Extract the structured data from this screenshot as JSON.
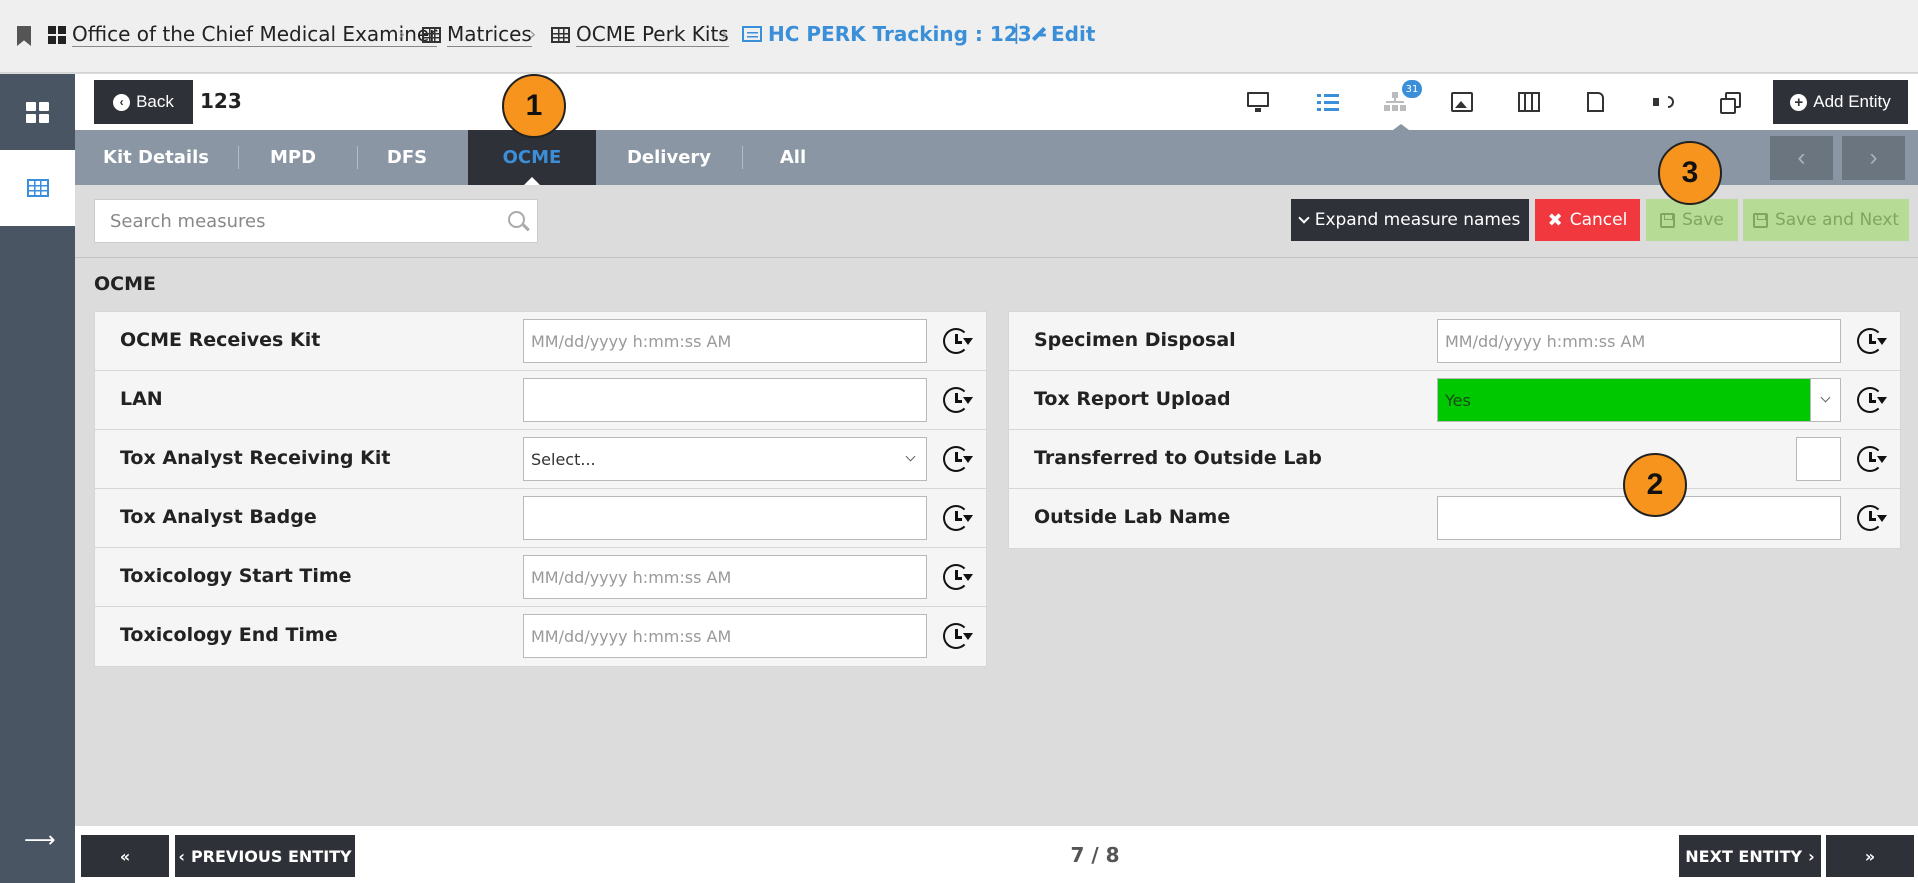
{
  "breadcrumb": {
    "items": [
      {
        "label": "Office of the Chief Medical Examiner",
        "icon": "dashboard-icon"
      },
      {
        "label": "Matrices",
        "icon": "table-icon"
      },
      {
        "label": "OCME Perk Kits",
        "icon": "table-icon"
      },
      {
        "label": "HC PERK Tracking : 123  -",
        "icon": "list-icon"
      }
    ],
    "separator": "›",
    "pipe": "|",
    "edit_label": "Edit"
  },
  "toolbar": {
    "back_label": "Back",
    "entity_id": "123",
    "list_badge": "31",
    "add_entity_label": "Add Entity"
  },
  "tabs": [
    {
      "label": "Kit Details"
    },
    {
      "label": "MPD"
    },
    {
      "label": "DFS"
    },
    {
      "label": "OCME",
      "active": true
    },
    {
      "label": "Delivery"
    },
    {
      "label": "All"
    }
  ],
  "nav": {
    "prev": "‹",
    "next": "›"
  },
  "actions": {
    "search_placeholder": "Search measures",
    "expand_label": "Expand measure names",
    "cancel_label": "Cancel",
    "save_label": "Save",
    "save_next_label": "Save and Next"
  },
  "section": {
    "title": "OCME",
    "left_fields": [
      {
        "label": "OCME Receives Kit",
        "type": "datetime",
        "placeholder": "MM/dd/yyyy h:mm:ss AM",
        "value": ""
      },
      {
        "label": "LAN",
        "type": "text",
        "value": ""
      },
      {
        "label": "Tox Analyst Receiving Kit",
        "type": "select",
        "value": "Select..."
      },
      {
        "label": "Tox Analyst Badge",
        "type": "text",
        "value": ""
      },
      {
        "label": "Toxicology Start Time",
        "type": "datetime",
        "placeholder": "MM/dd/yyyy h:mm:ss AM",
        "value": ""
      },
      {
        "label": "Toxicology End Time",
        "type": "datetime",
        "placeholder": "MM/dd/yyyy h:mm:ss AM",
        "value": ""
      }
    ],
    "right_fields": [
      {
        "label": "Specimen Disposal",
        "type": "datetime",
        "placeholder": "MM/dd/yyyy h:mm:ss AM",
        "value": ""
      },
      {
        "label": "Tox Report Upload",
        "type": "select",
        "value": "Yes",
        "color": "#00c800"
      },
      {
        "label": "Transferred to Outside Lab",
        "type": "checkbox",
        "value": ""
      },
      {
        "label": "Outside Lab Name",
        "type": "text",
        "value": ""
      }
    ]
  },
  "callouts": [
    "1",
    "2",
    "3"
  ],
  "footer": {
    "first_label": "«",
    "prev_label": "PREVIOUS ENTITY",
    "pager": "7 / 8",
    "next_label": "NEXT ENTITY",
    "last_label": "»"
  },
  "colors": {
    "accent": "#3b8fd8",
    "dark": "#2e3138",
    "tab_bar": "#8a96a3",
    "cancel": "#f0383e",
    "save_disabled": "#b6db95",
    "callout": "#f7941d"
  }
}
